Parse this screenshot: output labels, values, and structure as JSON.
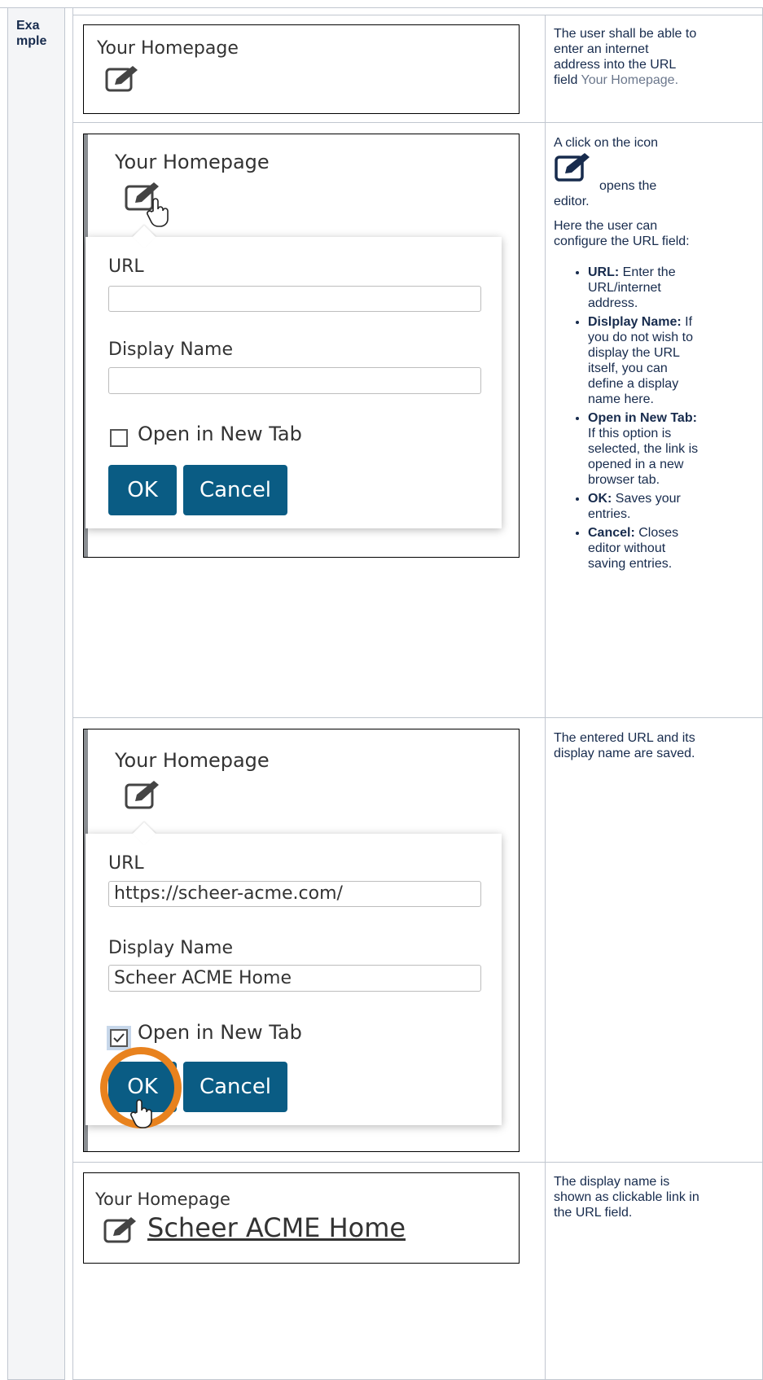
{
  "example_label": "Example",
  "row1": {
    "title": "Your Homepage",
    "desc_prefix": "The user shall be able to enter an internet address into the URL field ",
    "desc_link": "Your Homepage."
  },
  "row2": {
    "title": "Your Homepage",
    "url_label": "URL",
    "url_value": "",
    "display_label": "Display Name",
    "display_value": "",
    "newtab_label": "Open in New Tab",
    "ok": "OK",
    "cancel": "Cancel",
    "desc_a": "A click on the icon",
    "desc_b": "opens the editor.",
    "desc_c": "Here the user can configure the URL field:",
    "bullets": [
      {
        "term": "URL:",
        "text": " Enter the URL/internet address."
      },
      {
        "term": "Dislplay Name:",
        "text": " If you do not wish to display the URL itself, you can define a display name here."
      },
      {
        "term": "Open in New Tab:",
        "text": "  If this option is selected, the link is opened in a new browser tab."
      },
      {
        "term": "OK:",
        "text": " Saves your entries."
      },
      {
        "term": "Cancel:",
        "text": " Closes editor without saving entries."
      }
    ]
  },
  "row3": {
    "title": "Your Homepage",
    "url_label": "URL",
    "url_value": "https://scheer-acme.com/",
    "display_label": "Display Name",
    "display_value": "Scheer ACME Home",
    "newtab_label": "Open in New Tab",
    "ok": "OK",
    "cancel": "Cancel",
    "desc": "The entered URL and its display name are saved.",
    "highlight_color": "#e8821e"
  },
  "row4": {
    "title": "Your Homepage",
    "link": "Scheer ACME Home",
    "desc": "The display name is shown as clickable link in the URL field."
  }
}
